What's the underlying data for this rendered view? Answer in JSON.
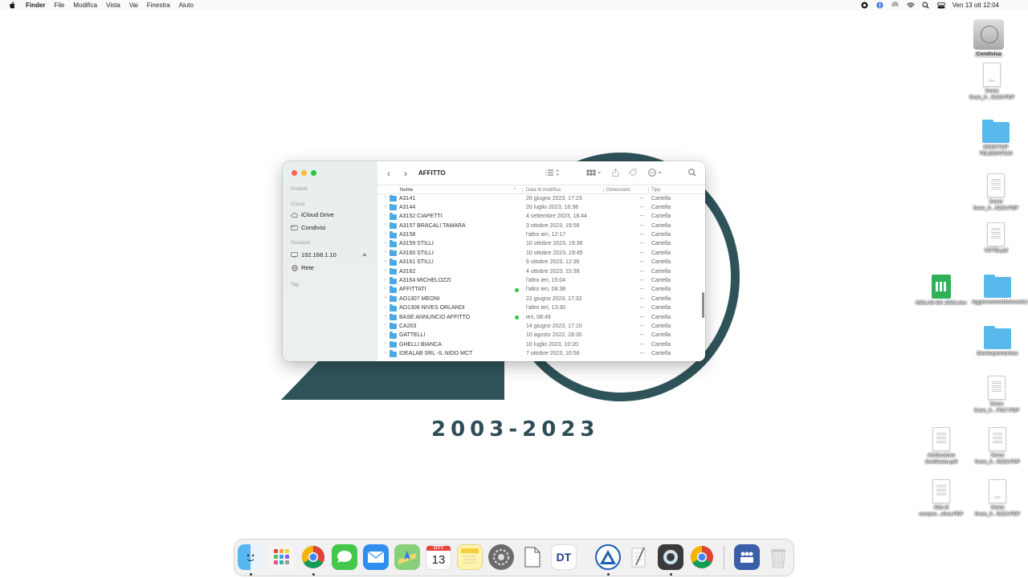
{
  "menubar": {
    "app": "Finder",
    "menus": [
      "File",
      "Modifica",
      "Vista",
      "Vai",
      "Finestra",
      "Aiuto"
    ],
    "clock": "Ven 13 ott  12:04"
  },
  "wallpaper": {
    "years": "2003-2023"
  },
  "finder": {
    "title": "AFFITTO",
    "sidebar": {
      "favorites_heading": "Preferiti",
      "icloud_heading": "iCloud",
      "icloud_items": [
        "iCloud Drive",
        "Condivisi"
      ],
      "locations_heading": "Posizioni",
      "locations": [
        "192.168.1.10",
        "Rete"
      ],
      "tags_heading": "Tag"
    },
    "columns": {
      "name": "Nome",
      "modified": "Data di modifica",
      "size": "Dimensioni",
      "kind": "Tipo"
    },
    "rows": [
      {
        "name": "A3141",
        "date": "26 giugno 2023, 17:23",
        "size": "--",
        "kind": "Cartella"
      },
      {
        "name": "A3144",
        "date": "20 luglio 2023, 16:38",
        "size": "--",
        "kind": "Cartella"
      },
      {
        "name": "A3152 CIAPETTI",
        "date": "4 settembre 2023, 18:44",
        "size": "--",
        "kind": "Cartella"
      },
      {
        "name": "A3157 BRACALI TAMARA",
        "date": "3 ottobre 2023, 19:58",
        "size": "--",
        "kind": "Cartella"
      },
      {
        "name": "A3158",
        "date": "l'altro ieri, 12:17",
        "size": "--",
        "kind": "Cartella"
      },
      {
        "name": "A3159 STILLI",
        "date": "10 ottobre 2023, 19:38",
        "size": "--",
        "kind": "Cartella"
      },
      {
        "name": "A3160 STILLI",
        "date": "10 ottobre 2023, 19:45",
        "size": "--",
        "kind": "Cartella"
      },
      {
        "name": "A3161 STILLI",
        "date": "6 ottobre 2023, 12:36",
        "size": "--",
        "kind": "Cartella"
      },
      {
        "name": "A3162",
        "date": "4 ottobre 2023, 15:38",
        "size": "--",
        "kind": "Cartella"
      },
      {
        "name": "A3164 MICHELOZZI",
        "date": "l'altro ieri, 15:04",
        "size": "--",
        "kind": "Cartella"
      },
      {
        "name": "AFFITTATI",
        "date": "l'altro ieri, 08:38",
        "size": "--",
        "kind": "Cartella",
        "tag": true
      },
      {
        "name": "AO1307 MEONI",
        "date": "22 giugno 2023, 17:32",
        "size": "--",
        "kind": "Cartella"
      },
      {
        "name": "AO1308 NIVES ORLANDI",
        "date": "l'altro ieri, 13:30",
        "size": "--",
        "kind": "Cartella"
      },
      {
        "name": "BASE ANNUNCIO AFFITTO",
        "date": "ieri, 08:49",
        "size": "--",
        "kind": "Cartella",
        "tag": true
      },
      {
        "name": "CA203",
        "date": "14 giugno 2023, 17:10",
        "size": "--",
        "kind": "Cartella"
      },
      {
        "name": "GATTELLI",
        "date": "10 agosto 2022, 18:30",
        "size": "--",
        "kind": "Cartella"
      },
      {
        "name": "GHELLI BIANCA",
        "date": "10 luglio 2023, 10:20",
        "size": "--",
        "kind": "Cartella"
      },
      {
        "name": "IDEALAB SRL -IL NIDO MCT",
        "date": "7 ottobre 2023, 10:58",
        "size": "--",
        "kind": "Cartella"
      }
    ]
  },
  "desktop": {
    "icons": [
      {
        "label": "Condivisa"
      },
      {
        "label": "Xerox Scan_0...5219.PDF"
      },
      {
        "label": "DESKTOP TELEMATICO"
      },
      {
        "label": "Xerox Scan_0...5219.PDF"
      },
      {
        "label": "7377B.pdf"
      },
      {
        "label": "MOLAS OK 2023.xlsx"
      },
      {
        "label": "Aggiornamentitelematici"
      },
      {
        "label": "Deskiopiomonitoc"
      },
      {
        "label": "Xerox Scan_0...7017.PDF"
      },
      {
        "label": "Attribuzione Certificato.pdf"
      },
      {
        "label": "Xerox Scan_0...5223.PDF"
      },
      {
        "label": "Atto di compra...aliva.PDF"
      },
      {
        "label": "Xerox Scan_0...5223.PDF"
      }
    ]
  },
  "dock": {
    "calendar_month": "OTT",
    "calendar_day": "13",
    "dt_label": "DT",
    "apps": [
      "Finder",
      "Launchpad",
      "Chrome",
      "Messaggi",
      "Mail",
      "Mappe",
      "Calendario",
      "Note",
      "Impostazioni",
      "Anteprima",
      "DT",
      "Connessione",
      "TextEdit",
      "Acquisizione",
      "Chrome",
      "Utenti",
      "Cestino"
    ]
  }
}
